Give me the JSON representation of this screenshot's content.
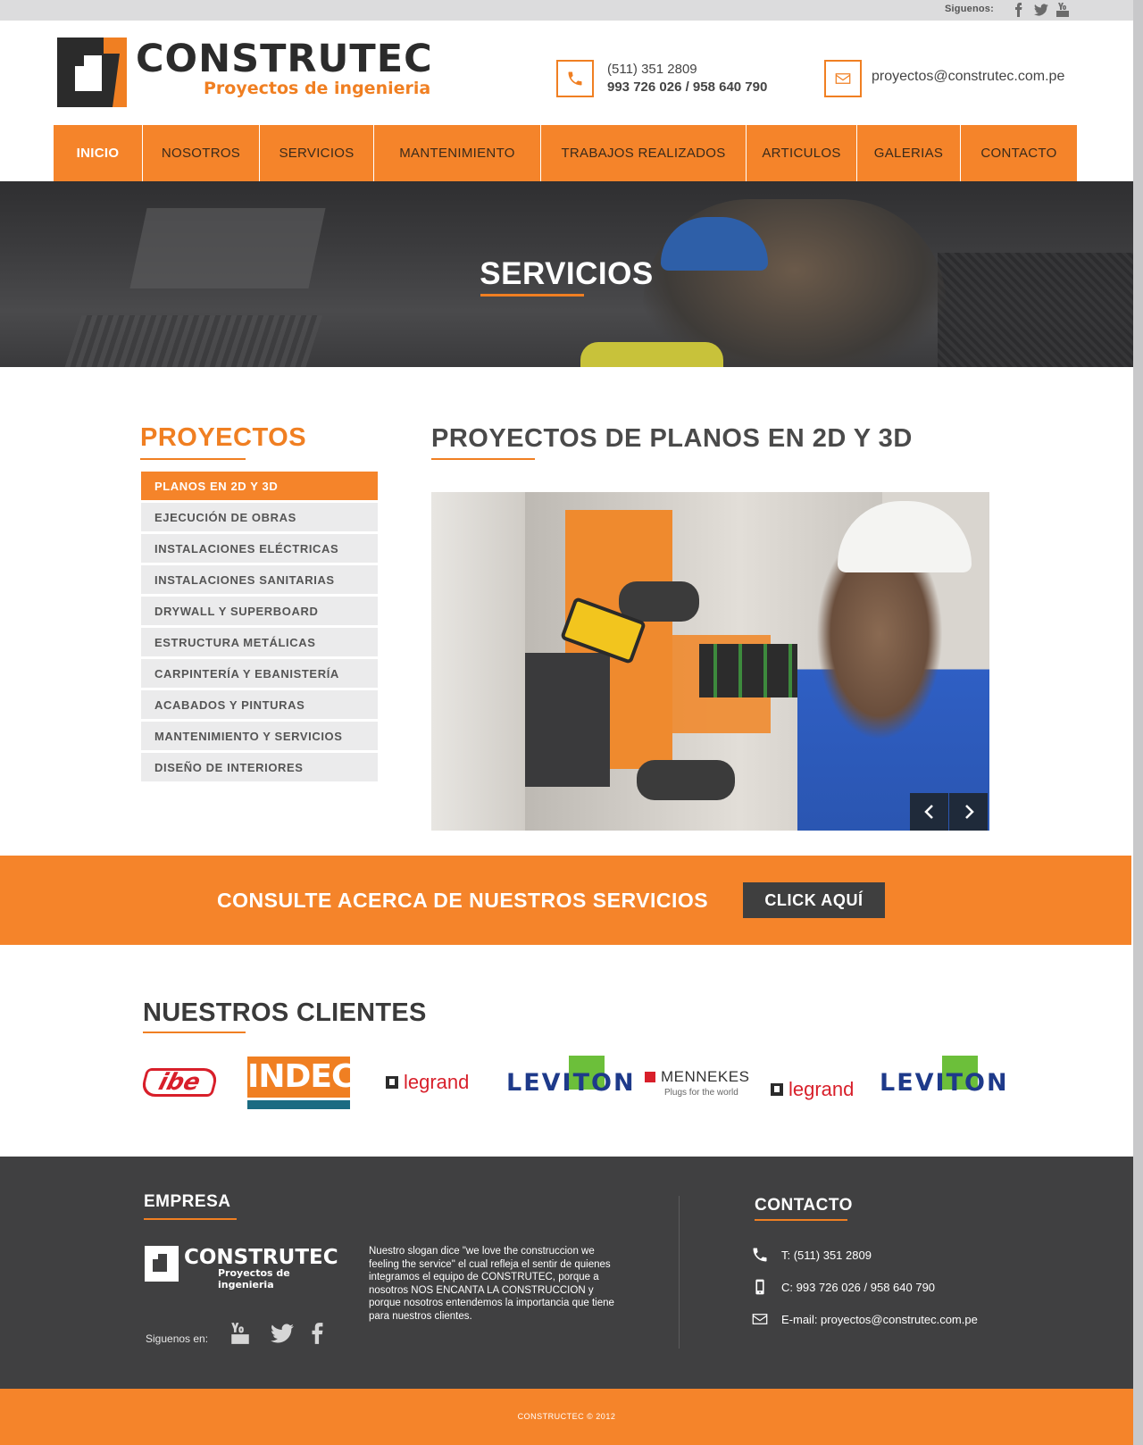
{
  "topbar": {
    "follow_label": "Siguenos:",
    "social_icons": [
      "facebook-icon",
      "twitter-icon",
      "youtube-icon"
    ]
  },
  "header": {
    "brand": "CONSTRUTEC",
    "tagline": "Proyectos de ingenieria",
    "phone_line1": "(511) 351 2809",
    "phone_line2": "993 726 026 / 958 640 790",
    "email": "proyectos@construtec.com.pe"
  },
  "nav": {
    "items": [
      {
        "label": "INICIO",
        "active": true
      },
      {
        "label": "NOSOTROS"
      },
      {
        "label": "SERVICIOS"
      },
      {
        "label": "MANTENIMIENTO"
      },
      {
        "label": "TRABAJOS REALIZADOS"
      },
      {
        "label": "ARTICULOS"
      },
      {
        "label": "GALERIAS"
      },
      {
        "label": "CONTACTO"
      }
    ]
  },
  "hero": {
    "title": "SERVICIOS"
  },
  "sidebar": {
    "title": "PROYECTOS",
    "items": [
      {
        "label": "PLANOS EN 2D Y 3D",
        "active": true
      },
      {
        "label": "EJECUCIÓN DE OBRAS"
      },
      {
        "label": "INSTALACIONES ELÉCTRICAS"
      },
      {
        "label": "INSTALACIONES SANITARIAS"
      },
      {
        "label": "DRYWALL Y SUPERBOARD"
      },
      {
        "label": "ESTRUCTURA METÁLICAS"
      },
      {
        "label": "CARPINTERÍA Y EBANISTERÍA"
      },
      {
        "label": "ACABADOS Y PINTURAS"
      },
      {
        "label": "MANTENIMIENTO Y SERVICIOS"
      },
      {
        "label": "DISEÑO DE INTERIORES"
      }
    ]
  },
  "main": {
    "title": "PROYECTOS DE PLANOS EN 2D Y 3D"
  },
  "cta": {
    "text": "CONSULTE ACERCA DE NUESTROS SERVICIOS",
    "button": "CLICK AQUÍ"
  },
  "clients": {
    "title": "NUESTROS CLIENTES",
    "logos": {
      "ibe": "ibe",
      "indeco": "INDECO",
      "legrand": "legrand",
      "leviton": "LEVITON",
      "mennekes": "MENNEKES",
      "mennekes_sub": "Plugs for the world"
    }
  },
  "footer": {
    "empresa_title": "EMPRESA",
    "brand": "CONSTRUTEC",
    "tagline": "Proyectos de ingenieria",
    "follow_label": "Siguenos en:",
    "slogan": "Nuestro slogan dice \"we love the construccion we feeling the service\" el cual refleja el sentir de quienes integramos el equipo de CONSTRUTEC, porque a nosotros NOS ENCANTA LA CONSTRUCCION y porque nosotros entendemos la importancia que tiene para nuestros clientes.",
    "contact_title": "CONTACTO",
    "phone": "T: (511) 351 2809",
    "cell": "C: 993 726 026 / 958 640 790",
    "email": "E-mail: proyectos@construtec.com.pe",
    "copyright": "CONSTRUCTEC © 2012"
  },
  "colors": {
    "accent": "#f5842a",
    "dark": "#404041",
    "text": "#4a4a4a"
  }
}
